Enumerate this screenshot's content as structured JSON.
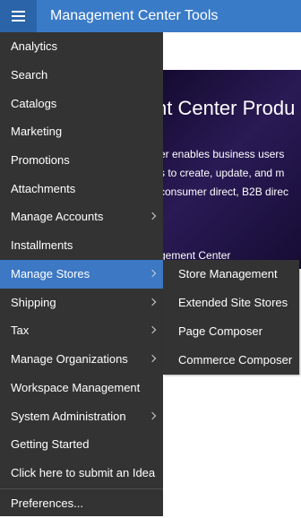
{
  "header": {
    "title": "Management Center Tools"
  },
  "background": {
    "heading": "nt Center Produ",
    "body_lines": [
      "er enables business users",
      "s to create, update, and m",
      "consumer direct, B2B direc"
    ],
    "footer": "gement Center"
  },
  "menu": {
    "items": [
      {
        "label": "Analytics"
      },
      {
        "label": "Search"
      },
      {
        "label": "Catalogs"
      },
      {
        "label": "Marketing"
      },
      {
        "label": "Promotions"
      },
      {
        "label": "Attachments"
      },
      {
        "label": "Manage Accounts"
      },
      {
        "label": "Installments"
      },
      {
        "label": "Manage Stores"
      },
      {
        "label": "Shipping"
      },
      {
        "label": "Tax"
      },
      {
        "label": "Manage Organizations"
      },
      {
        "label": "Workspace Management"
      },
      {
        "label": "System Administration"
      },
      {
        "label": "Getting Started"
      },
      {
        "label": "Click here to submit an Idea"
      },
      {
        "label": "Preferences..."
      }
    ]
  },
  "submenu": {
    "items": [
      {
        "label": "Store Management"
      },
      {
        "label": "Extended Site Stores"
      },
      {
        "label": "Page Composer"
      },
      {
        "label": "Commerce Composer"
      }
    ]
  },
  "colors": {
    "header": "#3a7bc8",
    "menu_bg": "#333333",
    "active": "#3c78c3"
  }
}
